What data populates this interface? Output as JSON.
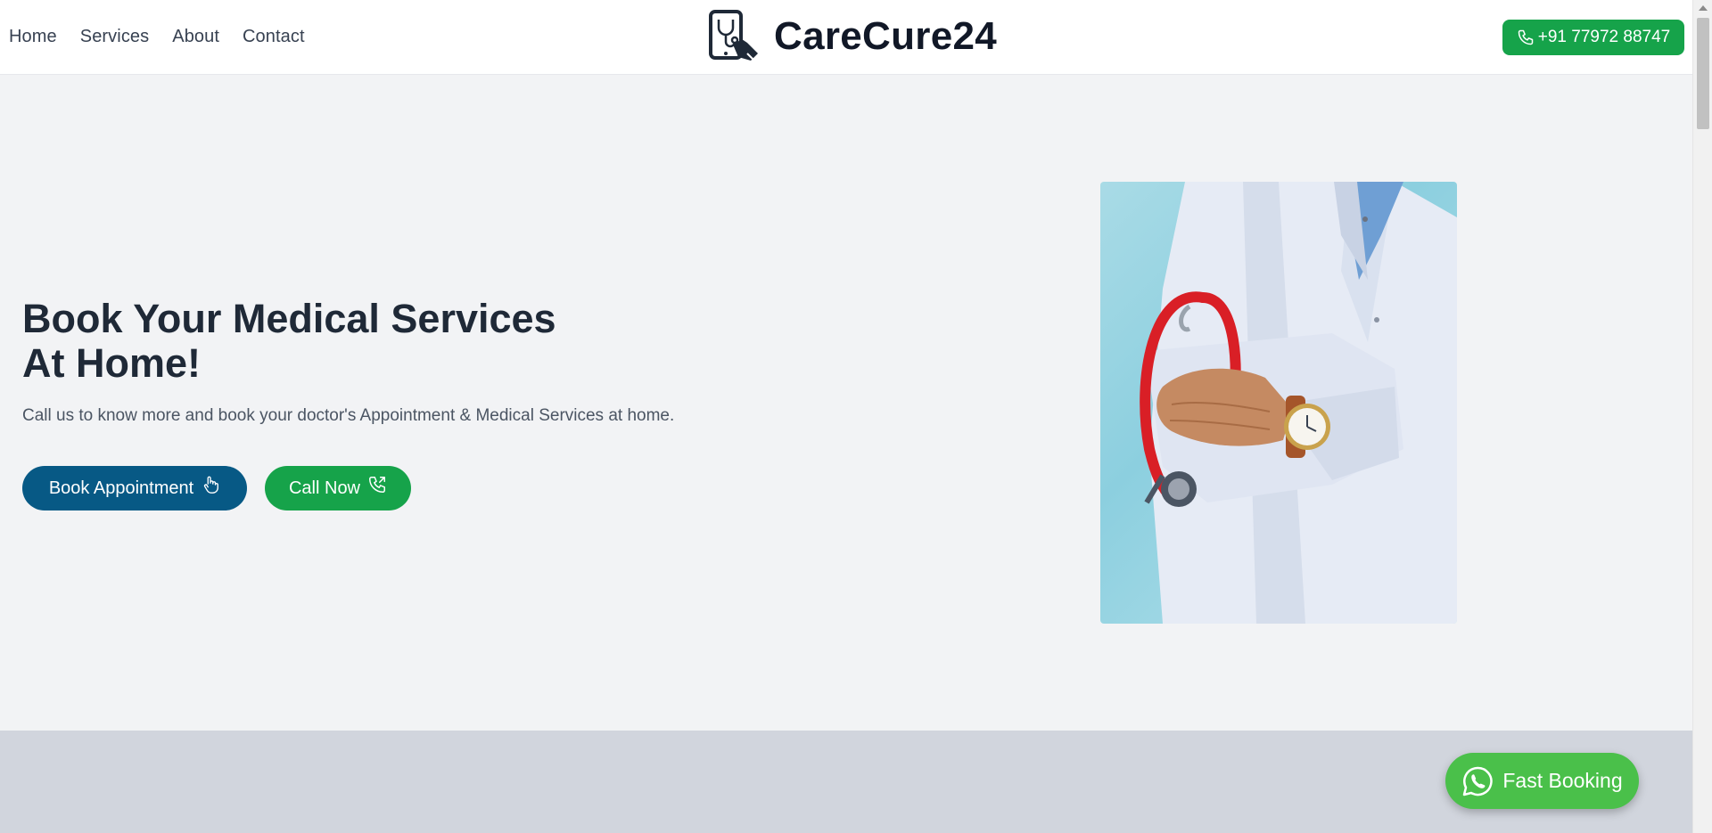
{
  "header": {
    "nav": [
      "Home",
      "Services",
      "About",
      "Contact"
    ],
    "brand": "CareCure24",
    "phone_label": "+91 77972 88747"
  },
  "hero": {
    "title_line1": "Book Your Medical Services",
    "title_line2": "At Home!",
    "subtitle": "Call us to know more and book your doctor's Appointment & Medical Services at home.",
    "book_label": "Book Appointment",
    "call_label": "Call Now"
  },
  "floating": {
    "fast_booking_label": "Fast Booking"
  },
  "icons": {
    "logo": "tablet-stethoscope-icon",
    "phone": "phone-icon",
    "book": "hand-pointer-icon",
    "call": "phone-outgoing-icon",
    "fast_booking": "whatsapp-icon"
  },
  "colors": {
    "primary_blue": "#075985",
    "green": "#16a34a",
    "whatsapp_green": "#4ac04a",
    "hero_bg": "#f2f3f5",
    "band_bg": "#d1d5dd"
  }
}
